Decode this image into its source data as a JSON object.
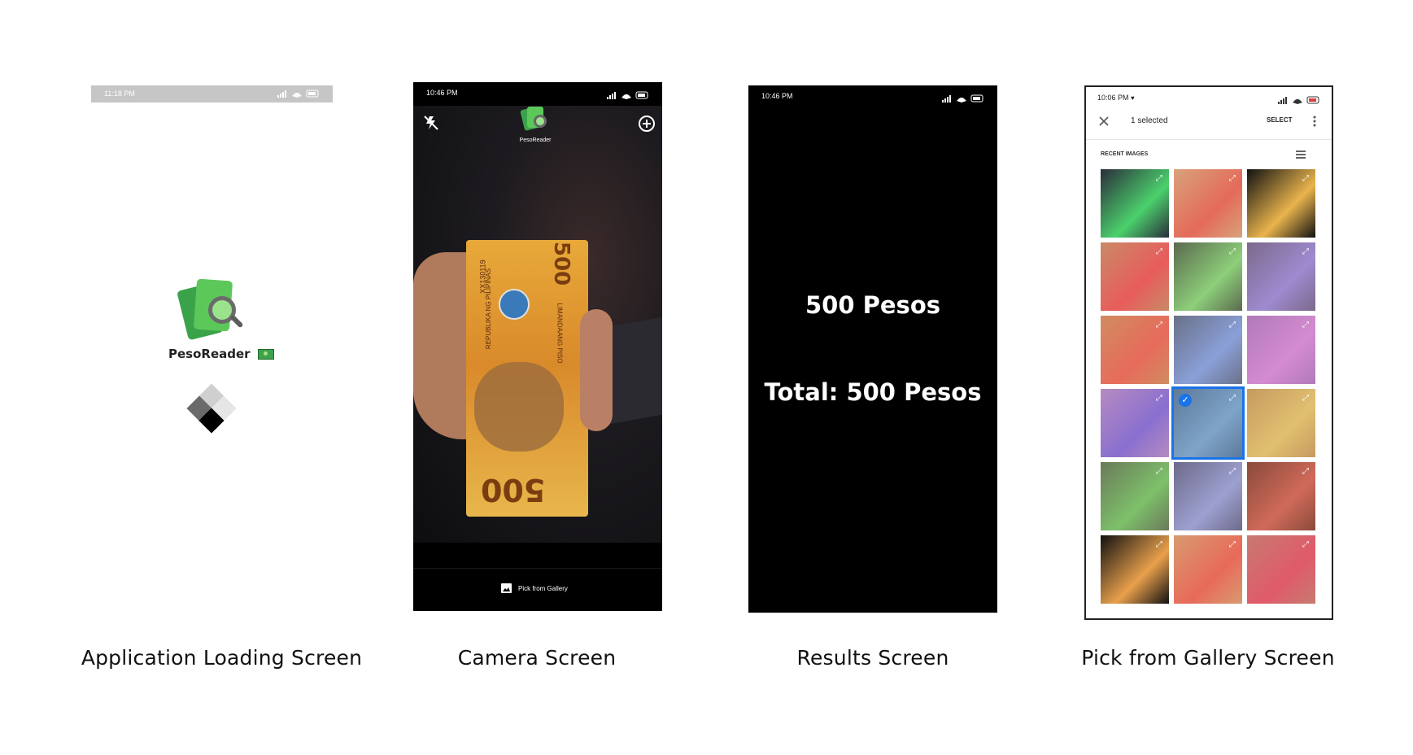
{
  "captions": {
    "loading": "Application Loading Screen",
    "camera": "Camera Screen",
    "results": "Results Screen",
    "gallery": "Pick from Gallery Screen"
  },
  "loading_screen": {
    "status_time": "11:18 PM",
    "app_name": "PesoReader"
  },
  "camera_screen": {
    "status_time": "10:46 PM",
    "app_logo_label": "PesoReader",
    "flash_icon": "flash-off-icon",
    "add_icon": "add-circle-icon",
    "pick_gallery_label": "Pick from Gallery",
    "banknote": {
      "denomination": "500",
      "serial": "XX130119",
      "issuer": "REPUBLIKA NG PILIPINAS",
      "text": "LIMANDAANG PISO"
    }
  },
  "results_screen": {
    "status_time": "10:46 PM",
    "result": "500 Pesos",
    "total": "Total: 500 Pesos"
  },
  "gallery_screen": {
    "status_time": "10:06 PM",
    "selected_count": "1 selected",
    "select_label": "SELECT",
    "section_title": "RECENT IMAGES",
    "thumbnails": [
      {
        "color": "#2a2d3a",
        "accent": "#4bd16c",
        "selected": false
      },
      {
        "color": "#d8a27a",
        "accent": "#e46a5a",
        "selected": false
      },
      {
        "color": "#111111",
        "accent": "#e9b44c",
        "selected": false
      },
      {
        "color": "#c98a66",
        "accent": "#e85c5c",
        "selected": false
      },
      {
        "color": "#5b6a4e",
        "accent": "#8dcf7a",
        "selected": false
      },
      {
        "color": "#7b6a8a",
        "accent": "#9f8ad0",
        "selected": false
      },
      {
        "color": "#d08c60",
        "accent": "#e76b5b",
        "selected": false
      },
      {
        "color": "#6a7088",
        "accent": "#8aa0d8",
        "selected": false
      },
      {
        "color": "#b07ab8",
        "accent": "#d48bd0",
        "selected": false
      },
      {
        "color": "#b58bc0",
        "accent": "#8a6fd0",
        "selected": false
      },
      {
        "color": "#5d7a9a",
        "accent": "#7ea4c8",
        "selected": true
      },
      {
        "color": "#c79a60",
        "accent": "#e0c070",
        "selected": false
      },
      {
        "color": "#6b7a5a",
        "accent": "#7dc06a",
        "selected": false
      },
      {
        "color": "#6d6a8a",
        "accent": "#9da0d0",
        "selected": false
      },
      {
        "color": "#8a4a3a",
        "accent": "#d06a5a",
        "selected": false
      },
      {
        "color": "#111111",
        "accent": "#e9a04c",
        "selected": false
      },
      {
        "color": "#d89a70",
        "accent": "#e86a5a",
        "selected": false
      },
      {
        "color": "#c87a70",
        "accent": "#e05a6a",
        "selected": false
      }
    ]
  },
  "colors": {
    "brand_green": "#5cc85a",
    "selection_blue": "#1a73e8"
  }
}
